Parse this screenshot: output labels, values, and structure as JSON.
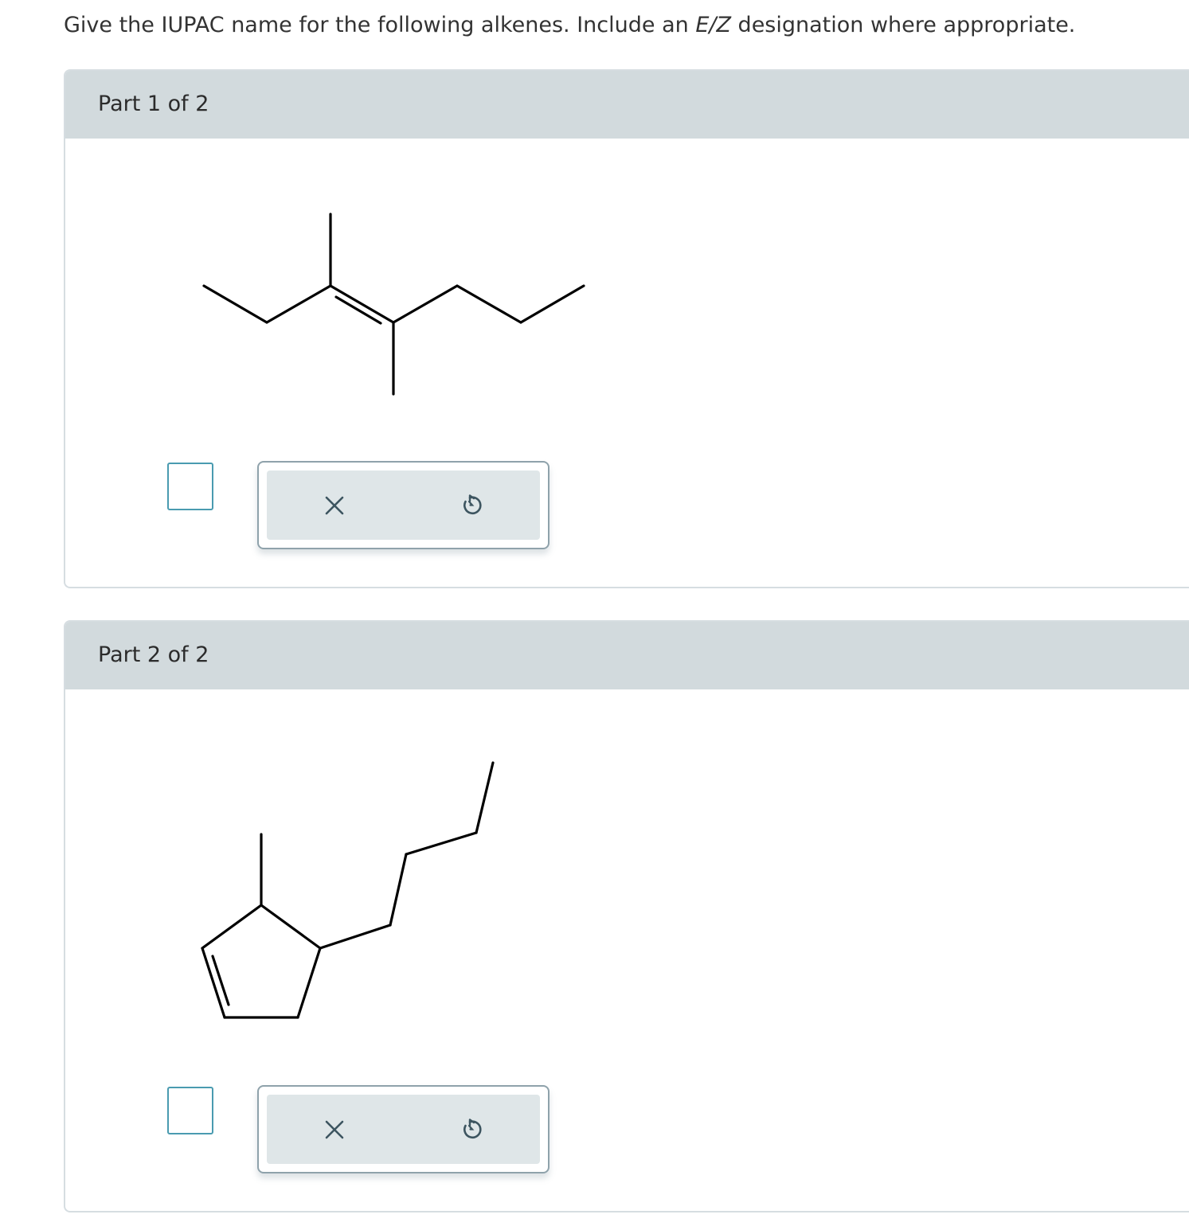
{
  "question": {
    "prefix": "Give the IUPAC name for the following alkenes. Include an ",
    "emphasis": "E/Z",
    "suffix": " designation where appropriate."
  },
  "parts": [
    {
      "title": "Part 1 of 2",
      "answer_value": "",
      "clear_icon": "close-x-icon",
      "reset_icon": "undo-circle-icon"
    },
    {
      "title": "Part 2 of 2",
      "answer_value": "",
      "clear_icon": "close-x-icon",
      "reset_icon": "undo-circle-icon"
    }
  ],
  "colors": {
    "header_bg": "#d2dadd",
    "answer_border": "#4a9bb0",
    "tool_bg": "#dfe6e8",
    "icon": "#3d5560"
  }
}
